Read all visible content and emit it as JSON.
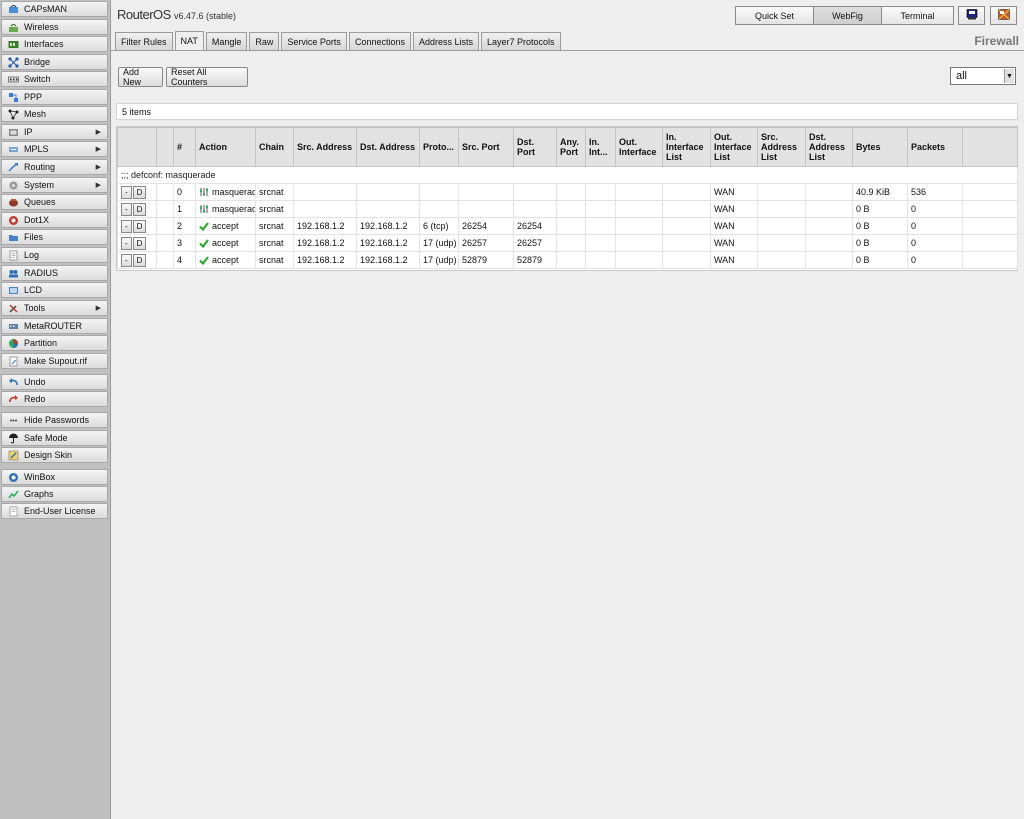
{
  "app": {
    "name": "RouterOS",
    "version": "v6.47.6 (stable)",
    "section": "Firewall"
  },
  "header": {
    "buttons": [
      {
        "label": "Quick Set"
      },
      {
        "label": "WebFig",
        "active": true
      },
      {
        "label": "Terminal"
      }
    ],
    "icon_buttons": [
      "monitor-icon",
      "flag-icon"
    ]
  },
  "sidebar": {
    "items": [
      {
        "label": "CAPsMAN",
        "icon": "capsman-icon"
      },
      {
        "label": "Wireless",
        "icon": "wireless-icon"
      },
      {
        "label": "Interfaces",
        "icon": "interfaces-icon"
      },
      {
        "label": "Bridge",
        "icon": "bridge-icon"
      },
      {
        "label": "Switch",
        "icon": "switch-icon"
      },
      {
        "label": "PPP",
        "icon": "ppp-icon"
      },
      {
        "label": "Mesh",
        "icon": "mesh-icon"
      },
      {
        "label": "IP",
        "icon": "ip-icon",
        "submenu": true
      },
      {
        "label": "MPLS",
        "icon": "mpls-icon",
        "submenu": true
      },
      {
        "label": "Routing",
        "icon": "routing-icon",
        "submenu": true
      },
      {
        "label": "System",
        "icon": "system-icon",
        "submenu": true
      },
      {
        "label": "Queues",
        "icon": "queues-icon"
      },
      {
        "label": "Dot1X",
        "icon": "dot1x-icon"
      },
      {
        "label": "Files",
        "icon": "files-icon"
      },
      {
        "label": "Log",
        "icon": "log-icon"
      },
      {
        "label": "RADIUS",
        "icon": "radius-icon"
      },
      {
        "label": "LCD",
        "icon": "lcd-icon"
      },
      {
        "label": "Tools",
        "icon": "tools-icon",
        "submenu": true
      },
      {
        "label": "MetaROUTER",
        "icon": "metarouter-icon"
      },
      {
        "label": "Partition",
        "icon": "partition-icon"
      },
      {
        "label": "Make Supout.rif",
        "icon": "supout-icon"
      },
      {
        "label": "Undo",
        "icon": "undo-icon"
      },
      {
        "label": "Redo",
        "icon": "redo-icon"
      },
      {
        "label": "Hide Passwords",
        "icon": "hide-passwords-icon"
      },
      {
        "label": "Safe Mode",
        "icon": "safe-mode-icon"
      },
      {
        "label": "Design Skin",
        "icon": "design-skin-icon"
      },
      {
        "label": "WinBox",
        "icon": "winbox-icon"
      },
      {
        "label": "Graphs",
        "icon": "graphs-icon"
      },
      {
        "label": "End-User License",
        "icon": "license-icon"
      }
    ]
  },
  "tabs": [
    {
      "label": "Filter Rules"
    },
    {
      "label": "NAT",
      "active": true
    },
    {
      "label": "Mangle"
    },
    {
      "label": "Raw"
    },
    {
      "label": "Service Ports"
    },
    {
      "label": "Connections"
    },
    {
      "label": "Address Lists"
    },
    {
      "label": "Layer7 Protocols"
    }
  ],
  "toolbar": {
    "add_label": "Add New",
    "reset_label": "Reset All Counters",
    "filter_value": "all"
  },
  "list": {
    "count_text": "5 items",
    "columns": [
      "",
      "",
      "#",
      "Action",
      "Chain",
      "Src. Address",
      "Dst. Address",
      "Proto...",
      "Src. Port",
      "Dst. Port",
      "Any. Port",
      "In. Int...",
      "Out. Interface",
      "In. Interface List",
      "Out. Interface List",
      "Src. Address List",
      "Dst. Address List",
      "Bytes",
      "Packets",
      ""
    ],
    "comment": ";;; defconf: masquerade",
    "row_buttons": [
      "-",
      "D"
    ],
    "rows": [
      {
        "num": "0",
        "action": "masquerade",
        "action_icon": "masquerade-icon",
        "chain": "srcnat",
        "src_address": "",
        "dst_address": "",
        "protocol": "",
        "src_port": "",
        "dst_port": "",
        "any_port": "",
        "in_interface": "",
        "out_interface": "",
        "in_interface_list": "",
        "out_interface_list": "WAN",
        "src_address_list": "",
        "dst_address_list": "",
        "bytes": "40.9 KiB",
        "packets": "536"
      },
      {
        "num": "1",
        "action": "masquerade",
        "action_icon": "masquerade-icon",
        "chain": "srcnat",
        "src_address": "",
        "dst_address": "",
        "protocol": "",
        "src_port": "",
        "dst_port": "",
        "any_port": "",
        "in_interface": "",
        "out_interface": "",
        "in_interface_list": "",
        "out_interface_list": "WAN",
        "src_address_list": "",
        "dst_address_list": "",
        "bytes": "0 B",
        "packets": "0"
      },
      {
        "num": "2",
        "action": "accept",
        "action_icon": "accept-icon",
        "chain": "srcnat",
        "src_address": "192.168.1.2",
        "dst_address": "192.168.1.2",
        "protocol": "6 (tcp)",
        "src_port": "26254",
        "dst_port": "26254",
        "any_port": "",
        "in_interface": "",
        "out_interface": "",
        "in_interface_list": "",
        "out_interface_list": "WAN",
        "src_address_list": "",
        "dst_address_list": "",
        "bytes": "0 B",
        "packets": "0"
      },
      {
        "num": "3",
        "action": "accept",
        "action_icon": "accept-icon",
        "chain": "srcnat",
        "src_address": "192.168.1.2",
        "dst_address": "192.168.1.2",
        "protocol": "17 (udp)",
        "src_port": "26257",
        "dst_port": "26257",
        "any_port": "",
        "in_interface": "",
        "out_interface": "",
        "in_interface_list": "",
        "out_interface_list": "WAN",
        "src_address_list": "",
        "dst_address_list": "",
        "bytes": "0 B",
        "packets": "0"
      },
      {
        "num": "4",
        "action": "accept",
        "action_icon": "accept-icon",
        "chain": "srcnat",
        "src_address": "192.168.1.2",
        "dst_address": "192.168.1.2",
        "protocol": "17 (udp)",
        "src_port": "52879",
        "dst_port": "52879",
        "any_port": "",
        "in_interface": "",
        "out_interface": "",
        "in_interface_list": "",
        "out_interface_list": "WAN",
        "src_address_list": "",
        "dst_address_list": "",
        "bytes": "0 B",
        "packets": "0"
      }
    ]
  },
  "colors": {
    "sidebar_bg": "#c0c0c0",
    "page_bg": "#eeeeee",
    "header_row": "#e2e2e2",
    "accept_green": "#2ea82e"
  }
}
